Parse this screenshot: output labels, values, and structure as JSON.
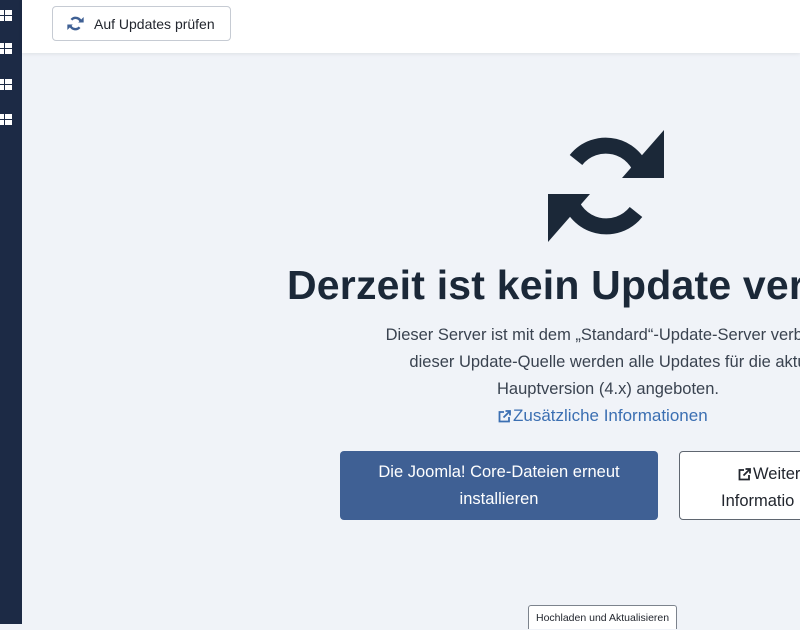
{
  "toolbar": {
    "check_updates_label": "Auf Updates prüfen",
    "icon": "sync-icon"
  },
  "sidebar": {
    "items": [
      {
        "icon": "grid-icon"
      },
      {
        "icon": "grid-icon"
      },
      {
        "icon": "grid-icon"
      },
      {
        "icon": "grid-icon"
      }
    ]
  },
  "main": {
    "icon": "sync-icon",
    "heading": "Derzeit ist kein Update verf",
    "description_lines": [
      "Dieser Server ist mit dem „Standard“-Update-Server verbund",
      "dieser Update-Quelle werden alle Updates für die aktu",
      "Hauptversion (4.x) angeboten."
    ],
    "info_link_label": "Zusätzliche Informationen",
    "reinstall_button_lines": [
      "Die Joomla! Core-Dateien erneut",
      "installieren"
    ],
    "more_info_button_lines": [
      "Weiter",
      "Informatio"
    ]
  },
  "tabs": {
    "upload_update_label": "Hochladen und Aktualisieren"
  },
  "colors": {
    "sidebar": "#1c2a45",
    "primary_button": "#3f6094",
    "link": "#3b6fb2",
    "heading": "#1b2838",
    "background": "#f0f3f8"
  }
}
